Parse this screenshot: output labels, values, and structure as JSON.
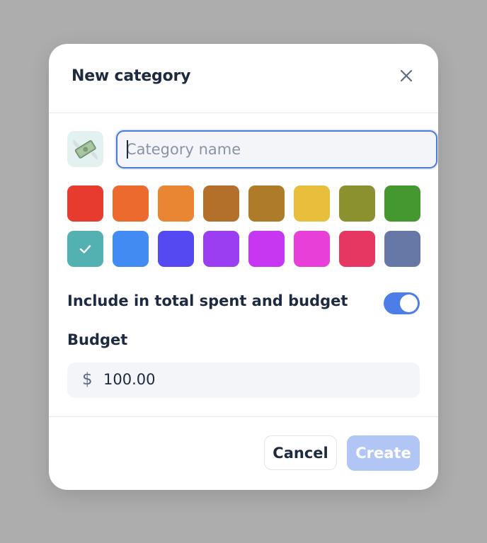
{
  "modal": {
    "title": "New category",
    "close_icon": "close-icon"
  },
  "emoji": {
    "icon": "money-with-wings-icon",
    "glyph": "💸"
  },
  "name_input": {
    "value": "",
    "placeholder": "Category name"
  },
  "colors": {
    "selected_index": 8,
    "swatches": [
      "#e83b30",
      "#ec6a2e",
      "#e88633",
      "#b2702a",
      "#ae7c29",
      "#e7bf3d",
      "#8a912f",
      "#45982f",
      "#54b1b1",
      "#418bf2",
      "#5549f2",
      "#9b3df1",
      "#c736f1",
      "#e83fd8",
      "#e53762",
      "#6777a6"
    ],
    "check_icon": "check-icon"
  },
  "include_toggle": {
    "label": "Include in total spent and budget",
    "on": true
  },
  "budget": {
    "label": "Budget",
    "currency_symbol": "$",
    "value": "100.00"
  },
  "footer": {
    "cancel_label": "Cancel",
    "create_label": "Create"
  }
}
